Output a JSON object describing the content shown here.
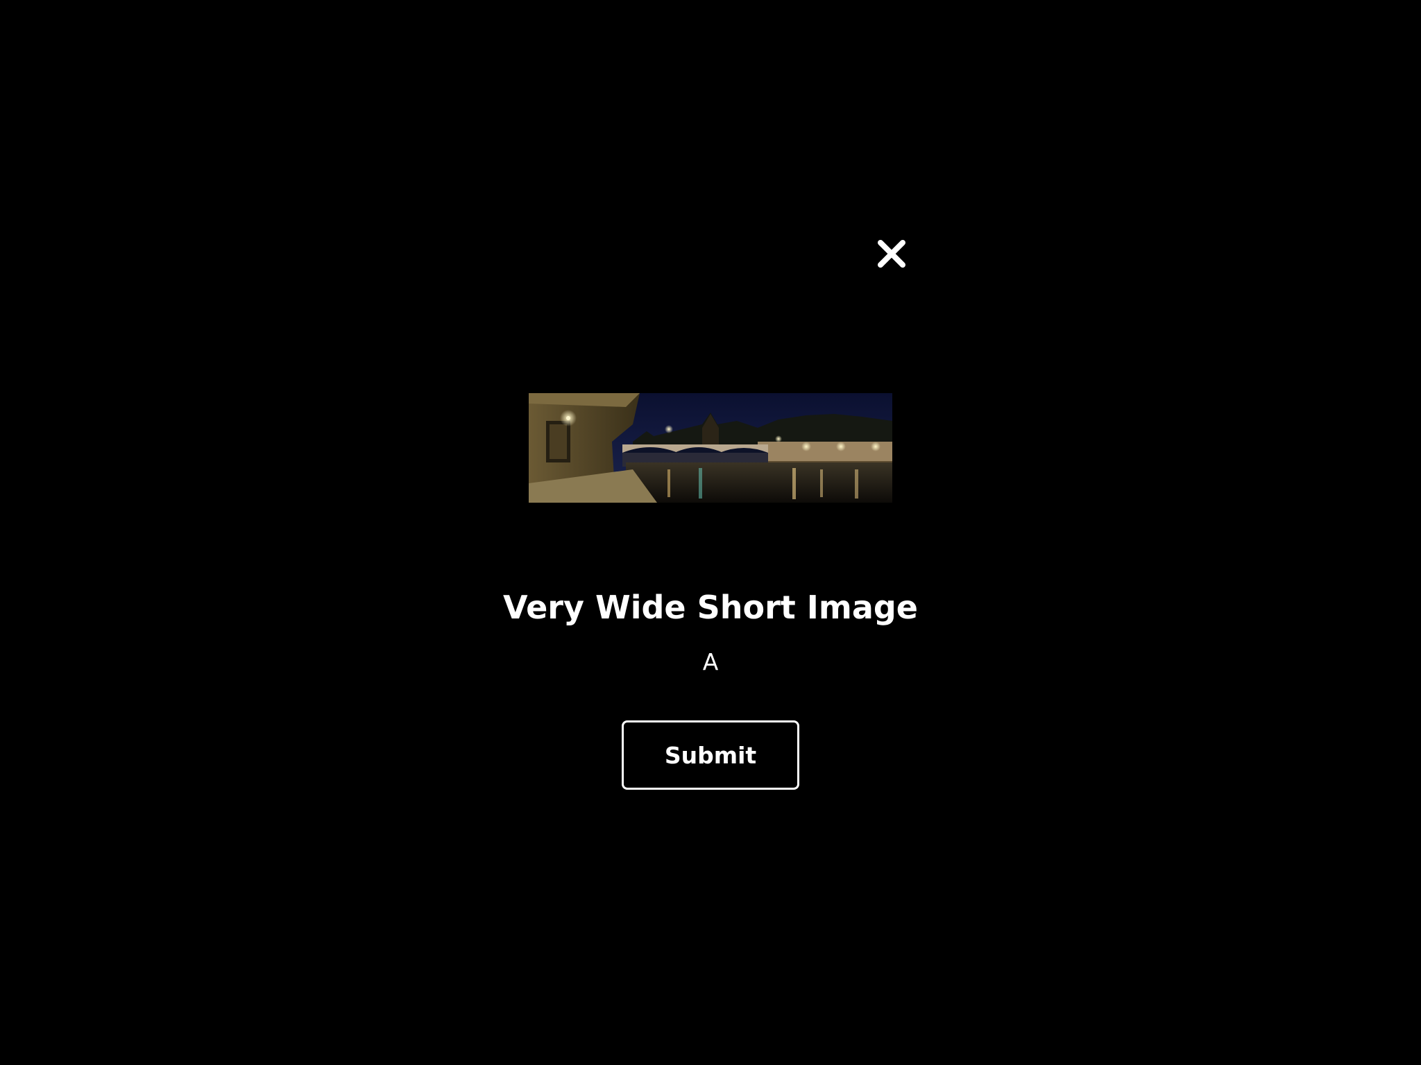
{
  "dialog": {
    "close_icon": "close-icon",
    "image_description_icon": "panorama-photo",
    "title": "Very Wide Short Image",
    "subtitle": "A",
    "submit_label": "Submit"
  },
  "colors": {
    "background": "#000000",
    "text": "#ffffff",
    "button_border": "#ffffff"
  }
}
